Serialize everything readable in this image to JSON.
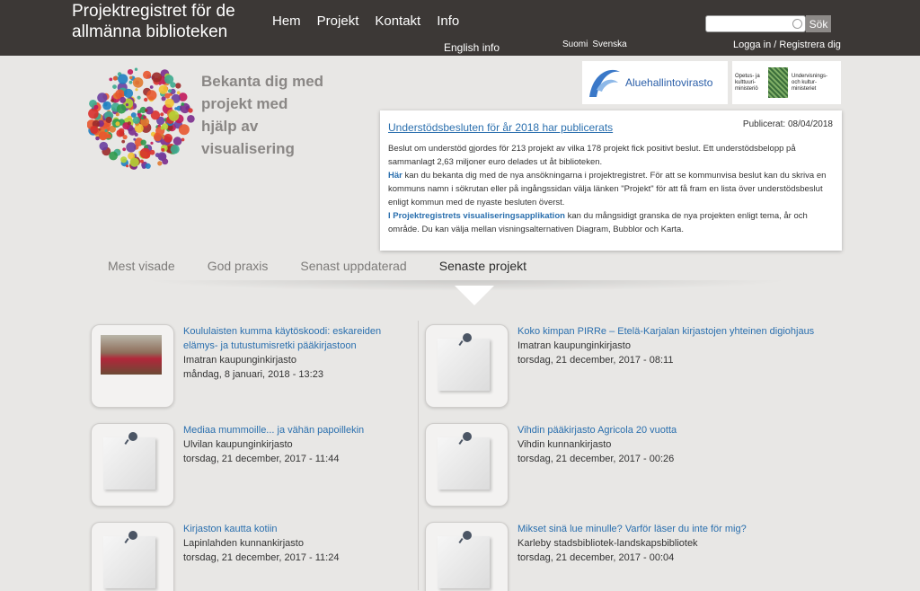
{
  "header": {
    "site_title": "Projektregistret för de allmänna biblioteken",
    "nav": [
      "Hem",
      "Projekt",
      "Kontakt",
      "Info"
    ],
    "english_info": "English info",
    "lang_links": [
      "Suomi",
      "Svenska"
    ],
    "search_placeholder": "",
    "search_button": "Sök",
    "login": "Logga in",
    "separator": "/",
    "register": "Registrera dig"
  },
  "hero": {
    "text": "Bekanta dig med projekt med hjälp av visualisering"
  },
  "logos": {
    "avi": "Aluehallintovirasto",
    "okm_fi": "Opetus- ja kulttuuri-ministeriö",
    "okm_sv": "Undervisnings- och kultur-ministeriet"
  },
  "news": {
    "title": "Understödsbesluten för år 2018 har publicerats",
    "date": "Publicerat: 08/04/2018",
    "p1": "Beslut om understöd gjordes för 213 projekt av vilka 178 projekt fick positivt beslut. Ett understödsbelopp på sammanlagt 2,63 miljoner euro delades ut åt biblioteken.",
    "p2_link": "Här",
    "p2": " kan du bekanta dig med de nya ansökningarna i projektregistret. För att se kommunvisa beslut kan du skriva en kommuns namn i sökrutan eller på ingångssidan välja länken \"Projekt\" för att få fram en lista över understödsbeslut enligt kommun med de nyaste besluten överst.",
    "p3_link": "I Projektregistrets visualiseringsapplikation",
    "p3": " kan du mångsidigt granska de nya projekten enligt tema, år och område. Du kan välja mellan visningsalternativen Diagram, Bubblor och Karta."
  },
  "tabs": [
    "Mest visade",
    "God praxis",
    "Senast uppdaterad",
    "Senaste projekt"
  ],
  "active_tab": "Senaste projekt",
  "items": [
    {
      "title": "Koululaisten kumma käytöskoodi: eskareiden elämys- ja tutustumisretki pääkirjastoon",
      "org": "Imatran kaupunginkirjasto",
      "date": "måndag, 8 januari, 2018 - 13:23",
      "thumb": "photo"
    },
    {
      "title": "Koko kimpan PIRRe – Etelä-Karjalan kirjastojen yhteinen digiohjaus",
      "org": "Imatran kaupunginkirjasto",
      "date": "torsdag, 21 december, 2017 - 08:11",
      "thumb": "note"
    },
    {
      "title": "Mediaa mummoille... ja vähän papoillekin",
      "org": "Ulvilan kaupunginkirjasto",
      "date": "torsdag, 21 december, 2017 - 11:44",
      "thumb": "note"
    },
    {
      "title": "Vihdin pääkirjasto Agricola 20 vuotta",
      "org": "Vihdin kunnankirjasto",
      "date": "torsdag, 21 december, 2017 - 00:26",
      "thumb": "note"
    },
    {
      "title": "Kirjaston kautta kotiin",
      "org": "Lapinlahden kunnankirjasto",
      "date": "torsdag, 21 december, 2017 - 11:24",
      "thumb": "note"
    },
    {
      "title": "Mikset sinä lue minulle? Varför läser du inte för mig?",
      "org": "Karleby stadsbibliotek-landskapsbibliotek",
      "date": "torsdag, 21 december, 2017 - 00:04",
      "thumb": "note"
    }
  ],
  "colors": {
    "header_bg": "#3c3836",
    "page_bg": "#e8e7e5",
    "link": "#2a6fae",
    "hero_text": "#8a8785"
  }
}
